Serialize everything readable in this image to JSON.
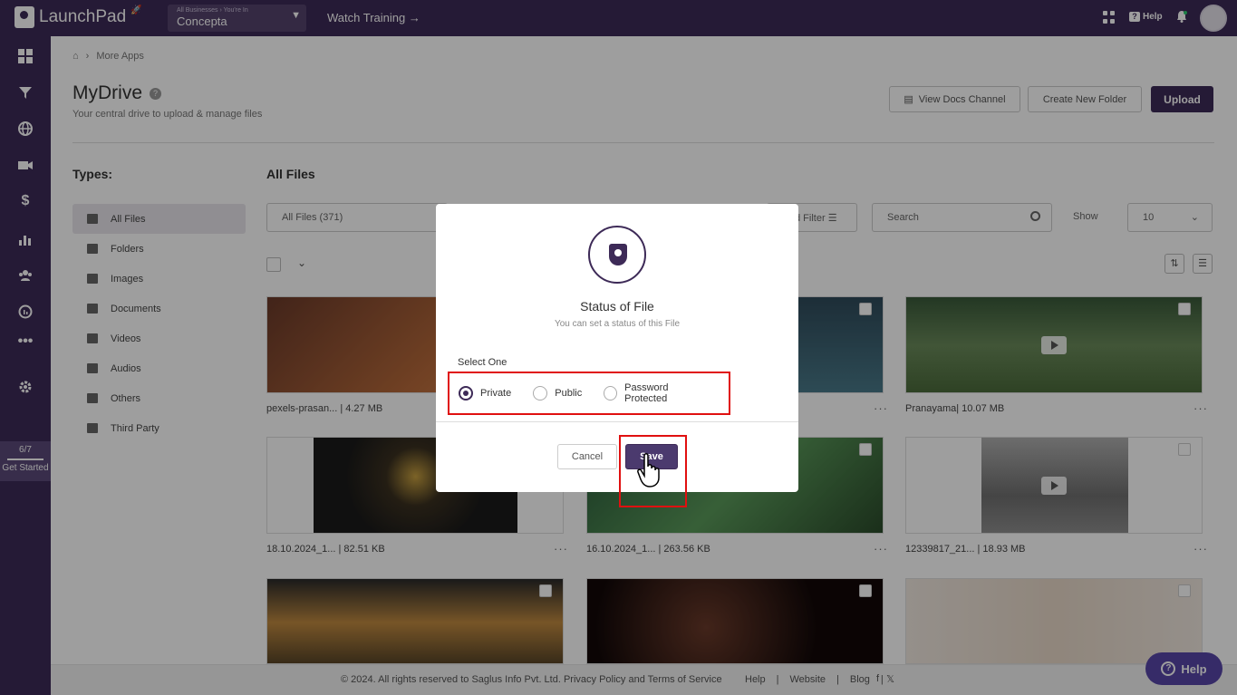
{
  "topbar": {
    "logo": "LaunchPad",
    "business_hint": "All Businesses › You're In",
    "business_name": "Concepta",
    "watch_training": "Watch Training →",
    "help": "Help"
  },
  "sidebar": {
    "icons": [
      "dashboard-icon",
      "filter-icon",
      "globe-icon",
      "video-icon",
      "dollar-icon",
      "chart-icon",
      "users-icon",
      "analytics-icon",
      "more-icon",
      "gear-icon"
    ],
    "progress": "6/7",
    "get_started": "Get Started",
    "progress_fraction": 0.857
  },
  "breadcrumb": {
    "current": "More Apps"
  },
  "page": {
    "title": "MyDrive",
    "subtitle": "Your central drive to upload & manage files",
    "view_docs": "View Docs Channel",
    "create_folder": "Create New Folder",
    "upload": "Upload"
  },
  "types": {
    "heading": "Types:",
    "items": [
      {
        "label": "All Files"
      },
      {
        "label": "Folders"
      },
      {
        "label": "Images"
      },
      {
        "label": "Documents"
      },
      {
        "label": "Videos"
      },
      {
        "label": "Audios"
      },
      {
        "label": "Others"
      },
      {
        "label": "Third Party"
      }
    ]
  },
  "files": {
    "heading": "All Files",
    "filter_value": "All Files (371)",
    "filter_btn": "d Filter",
    "search_placeholder": "Search",
    "show_label": "Show",
    "show_value": "10",
    "cards": [
      {
        "caption": "pexels-prasan... | 4.27 MB",
        "color": "#7a4a30"
      },
      {
        "caption": "",
        "color": "#2f5a6a"
      },
      {
        "caption": "Pranayama| 10.07 MB",
        "color": "#5a7a4a"
      },
      {
        "caption": "18.10.2024_1... | 82.51 KB",
        "color": "#2a2a2a"
      },
      {
        "caption": "16.10.2024_1... | 263.56 KB",
        "color": "#3a6a3a"
      },
      {
        "caption": "12339817_21... | 18.93 MB",
        "color": "#8a8a8a"
      },
      {
        "caption": "",
        "color": "#3a2a20"
      },
      {
        "caption": "",
        "color": "#1a1010"
      },
      {
        "caption": "",
        "color": "#e8e4e0"
      }
    ]
  },
  "footer": {
    "copyright": "©  2024. All rights reserved to Saglus Info Pvt. Ltd. Privacy Policy and Terms of Service",
    "links": [
      "Help",
      "Website",
      "Blog"
    ]
  },
  "help_fab": "Help",
  "modal": {
    "title": "Status of File",
    "subtitle": "You can set a status of this File",
    "select_label": "Select One",
    "options": [
      "Private",
      "Public",
      "Password Protected"
    ],
    "selected": "Private",
    "cancel": "Cancel",
    "save": "Save"
  },
  "colors": {
    "brand": "#3d2a57",
    "highlight": "#e01010",
    "help_fab": "#5846a8"
  }
}
